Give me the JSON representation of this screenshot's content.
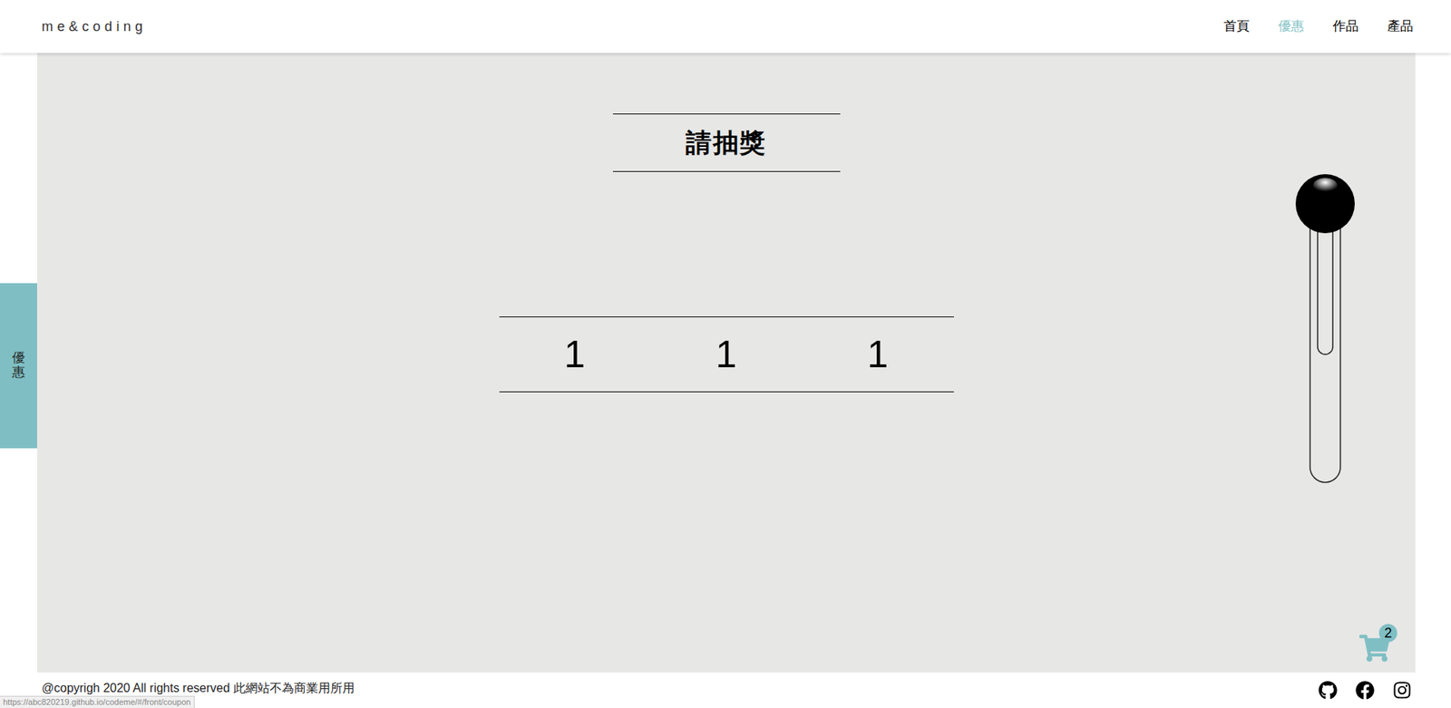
{
  "header": {
    "logo": "me&coding",
    "nav": [
      {
        "label": "首頁",
        "selected": false
      },
      {
        "label": "優惠",
        "selected": true
      },
      {
        "label": "作品",
        "selected": false
      },
      {
        "label": "產品",
        "selected": false
      }
    ]
  },
  "side_tab": {
    "label": "優惠"
  },
  "lottery": {
    "title": "請抽獎",
    "slots": [
      "1",
      "1",
      "1"
    ]
  },
  "cart": {
    "count": "2"
  },
  "footer": {
    "copyright": "@copyrigh 2020 All rights reserved 此網站不為商業用所用"
  },
  "status_bar": {
    "url": "https://abc820219.github.io/codeme/#/front/coupon"
  }
}
